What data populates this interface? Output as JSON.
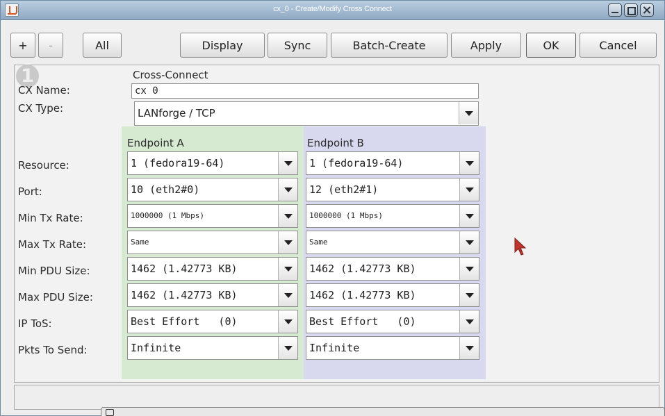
{
  "window": {
    "title": "cx_0 - Create/Modify Cross Connect"
  },
  "toolbar": {
    "add_label": "+",
    "remove_label": "-",
    "all_label": "All",
    "display_label": "Display",
    "sync_label": "Sync",
    "batch_create_label": "Batch-Create",
    "apply_label": "Apply",
    "ok_label": "OK",
    "cancel_label": "Cancel"
  },
  "form": {
    "badge": "1",
    "section_label": "Cross-Connect",
    "cx_name_label": "CX Name:",
    "cx_name_value": "cx 0",
    "cx_type_label": "CX Type:",
    "cx_type_value": "LANforge / TCP",
    "endpoint_a_label": "Endpoint A",
    "endpoint_b_label": "Endpoint B",
    "rows": [
      {
        "label": "Resource:",
        "a": "1 (fedora19-64)",
        "b": "1 (fedora19-64)"
      },
      {
        "label": "Port:",
        "a": "10 (eth2#0)",
        "b": "12 (eth2#1)"
      },
      {
        "label": "Min Tx Rate:",
        "a": "1000000 (1 Mbps)",
        "b": "1000000 (1 Mbps)"
      },
      {
        "label": "Max Tx Rate:",
        "a": "Same",
        "b": "Same"
      },
      {
        "label": "Min PDU Size:",
        "a": "1462 (1.42773 KB)",
        "b": "1462 (1.42773 KB)"
      },
      {
        "label": "Max PDU Size:",
        "a": "1462 (1.42773 KB)",
        "b": "1462 (1.42773 KB)"
      },
      {
        "label": "IP ToS:",
        "a": "Best Effort   (0)",
        "b": "Best Effort   (0)"
      },
      {
        "label": "Pkts To Send:",
        "a": "Infinite",
        "b": "Infinite"
      }
    ]
  },
  "colors": {
    "endpoint_a_bg": "#d6ead1",
    "endpoint_b_bg": "#d8d8ef",
    "titlebar": "#a3bbd2"
  },
  "icons": {
    "app": "java-cup-icon",
    "minimize": "minimize-icon",
    "maximize": "maximize-icon",
    "close": "close-icon",
    "cursor": "mouse-pointer-icon"
  }
}
